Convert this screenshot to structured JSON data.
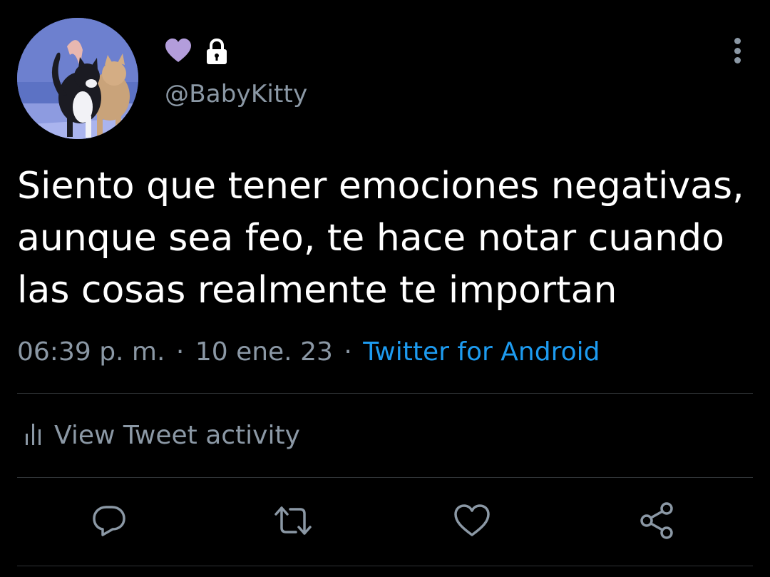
{
  "profile": {
    "avatar_icon": "cats-avatar",
    "badges": [
      {
        "icon": "purple-heart-icon",
        "color": "#b39ddb"
      },
      {
        "icon": "lock-icon",
        "color": "#ffffff"
      }
    ],
    "handle": "@BabyKitty"
  },
  "tweet": {
    "text": "Siento que tener emociones negativas, aunque sea feo, te hace notar cuando las cosas realmente te importan",
    "time": "06:39 p. m.",
    "separator": "·",
    "date": "10 ene. 23",
    "source": "Twitter for Android"
  },
  "activity": {
    "icon": "bar-chart-icon",
    "label": "View Tweet activity"
  },
  "actions": {
    "reply_icon": "reply-icon",
    "retweet_icon": "retweet-icon",
    "like_icon": "heart-icon",
    "share_icon": "share-icon"
  },
  "colors": {
    "background": "#000000",
    "text": "#ffffff",
    "secondary_text": "#8b98a5",
    "link": "#1d9bf0",
    "divider": "#2f3336"
  }
}
